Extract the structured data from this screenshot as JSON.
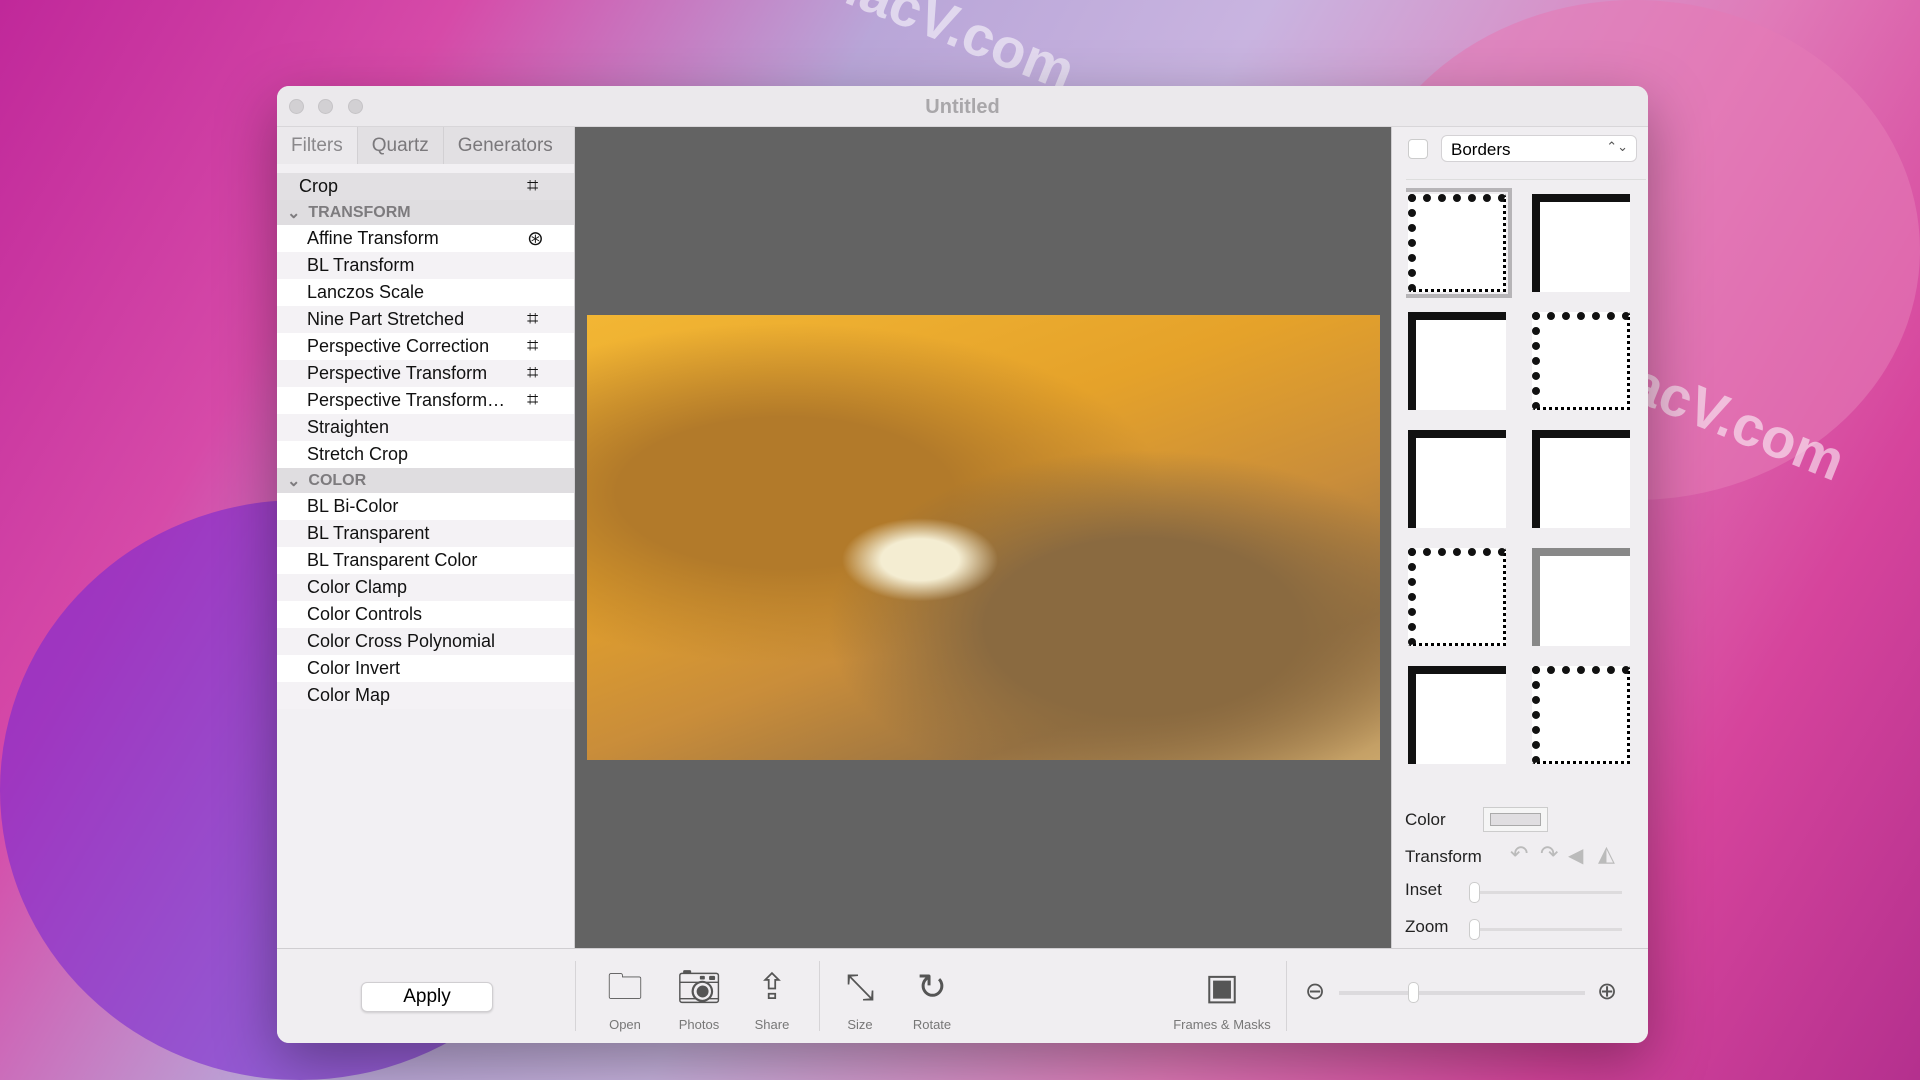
{
  "watermark": "MacV.com",
  "window": {
    "title": "Untitled"
  },
  "sidebar": {
    "tabs": [
      "Filters",
      "Quartz",
      "Generators"
    ],
    "crop": "Crop",
    "sections": [
      {
        "header": "TRANSFORM",
        "items": [
          {
            "label": "Affine Transform",
            "icon": "target-icon"
          },
          {
            "label": "BL Transform"
          },
          {
            "label": "Lanczos Scale"
          },
          {
            "label": "Nine Part Stretched",
            "icon": "grid-crosshair-icon"
          },
          {
            "label": "Perspective Correction",
            "icon": "grid-crosshair-icon"
          },
          {
            "label": "Perspective Transform",
            "icon": "grid-crosshair-icon"
          },
          {
            "label": "Perspective Transform…",
            "icon": "grid-crosshair-icon"
          },
          {
            "label": "Straighten"
          },
          {
            "label": "Stretch Crop"
          }
        ]
      },
      {
        "header": "COLOR",
        "items": [
          {
            "label": "BL Bi-Color"
          },
          {
            "label": "BL Transparent"
          },
          {
            "label": "BL Transparent Color"
          },
          {
            "label": "Color Clamp"
          },
          {
            "label": "Color Controls"
          },
          {
            "label": "Color Cross Polynomial"
          },
          {
            "label": "Color Invert"
          },
          {
            "label": "Color Map"
          }
        ]
      }
    ]
  },
  "right_panel": {
    "dropdown": "Borders",
    "color_label": "Color",
    "color_value": "#e0dee1",
    "transform_label": "Transform",
    "inset_label": "Inset",
    "inset_value": 0,
    "zoom_label": "Zoom",
    "zoom_value": 0
  },
  "toolbar": {
    "apply": "Apply",
    "open": "Open",
    "photos": "Photos",
    "share": "Share",
    "size": "Size",
    "rotate": "Rotate",
    "frames": "Frames & Masks",
    "zoom_level": 0.3
  }
}
